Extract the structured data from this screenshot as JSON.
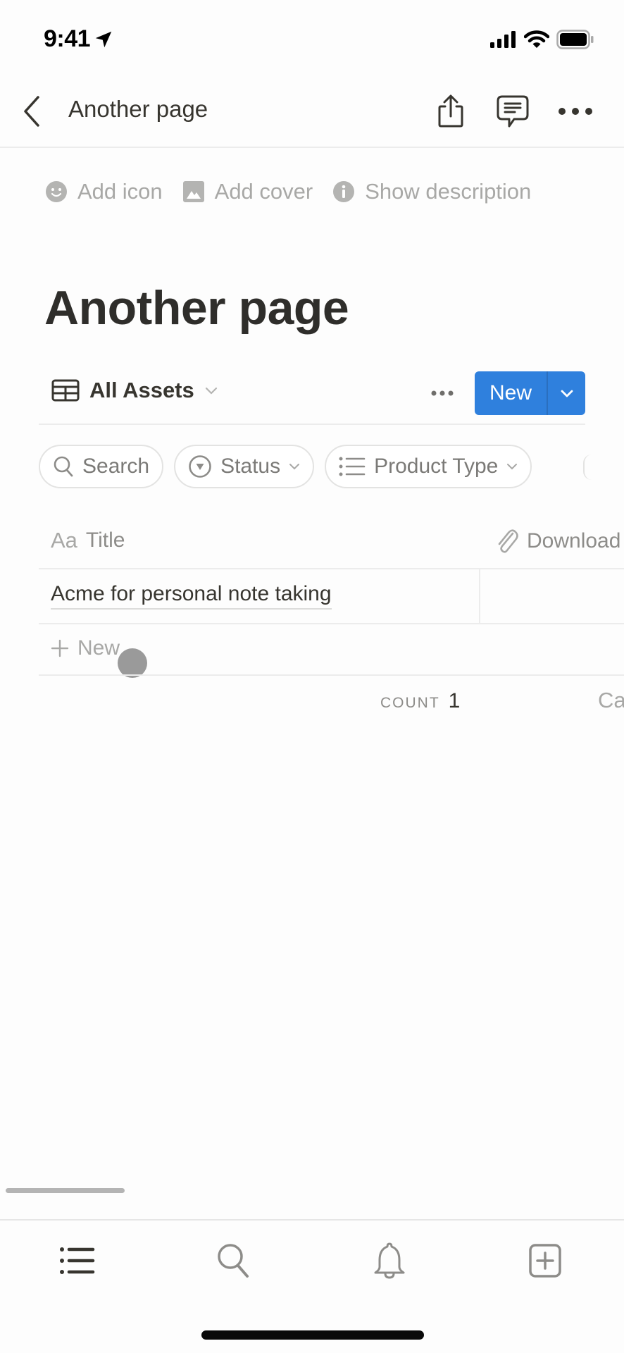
{
  "status_bar": {
    "time": "9:41",
    "icons": [
      "location-arrow-icon",
      "cellular-signal-icon",
      "wifi-icon",
      "battery-icon"
    ]
  },
  "nav": {
    "title": "Another page",
    "back_icon": "chevron-left-icon",
    "actions": [
      "share-icon",
      "comment-icon",
      "more-icon"
    ]
  },
  "page_meta": {
    "add_icon": "Add icon",
    "add_cover": "Add cover",
    "show_description": "Show description"
  },
  "page": {
    "title": "Another page"
  },
  "database": {
    "view_name": "All Assets",
    "view_icon": "table-icon",
    "new_button": "New",
    "filters": [
      {
        "label": "Search",
        "icon": "search-icon"
      },
      {
        "label": "Status",
        "icon": "status-icon"
      },
      {
        "label": "Product Type",
        "icon": "list-icon"
      }
    ],
    "columns": [
      {
        "label": "Title",
        "icon_text": "Aa"
      },
      {
        "label": "Download",
        "icon": "paperclip-icon"
      }
    ],
    "rows": [
      {
        "title": "Acme for personal note taking",
        "download": ""
      }
    ],
    "add_row_label": "New",
    "footer": {
      "count_label": "COUNT",
      "count_value": "1",
      "next_calc_partial": "Ca"
    }
  },
  "tab_bar": {
    "tabs": [
      "home-list-icon",
      "search-icon",
      "notifications-bell-icon",
      "new-page-icon"
    ]
  },
  "colors": {
    "accent": "#2f80dd",
    "text": "#37352f",
    "muted": "#a8a8a6"
  }
}
